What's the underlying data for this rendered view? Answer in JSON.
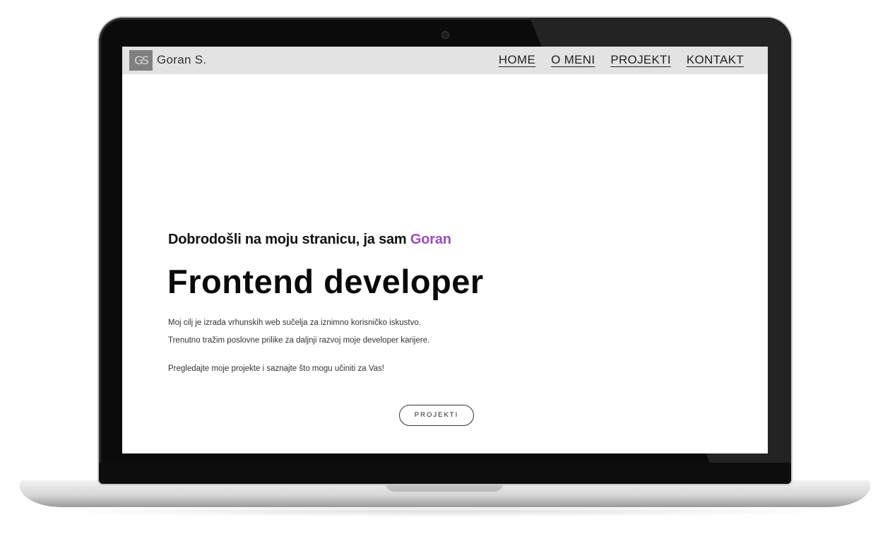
{
  "header": {
    "logo_text": "GS",
    "brand_name": "Goran S.",
    "nav": [
      "HOME",
      "O MENI",
      "PROJEKTI",
      "KONTAKT"
    ]
  },
  "hero": {
    "welcome_prefix": "Dobrodošli na moju stranicu, ja sam ",
    "welcome_name": "Goran",
    "headline": "Frontend developer",
    "paragraphs": [
      "Moj cilj je izrada vrhunskih web sučelja za iznimno korisničko iskustvo.",
      "Trenutno tražim poslovne prilike za daljnji razvoj moje developer karijere.",
      "Pregledajte moje projekte i saznajte što mogu učiniti za Vas!"
    ],
    "cta_label": "PROJEKTI"
  },
  "colors": {
    "accent": "#9b4dbd",
    "navbar": "#e3e3e3",
    "logo_bg": "#7f7f7f"
  },
  "icons": [
    "webcam-icon"
  ]
}
